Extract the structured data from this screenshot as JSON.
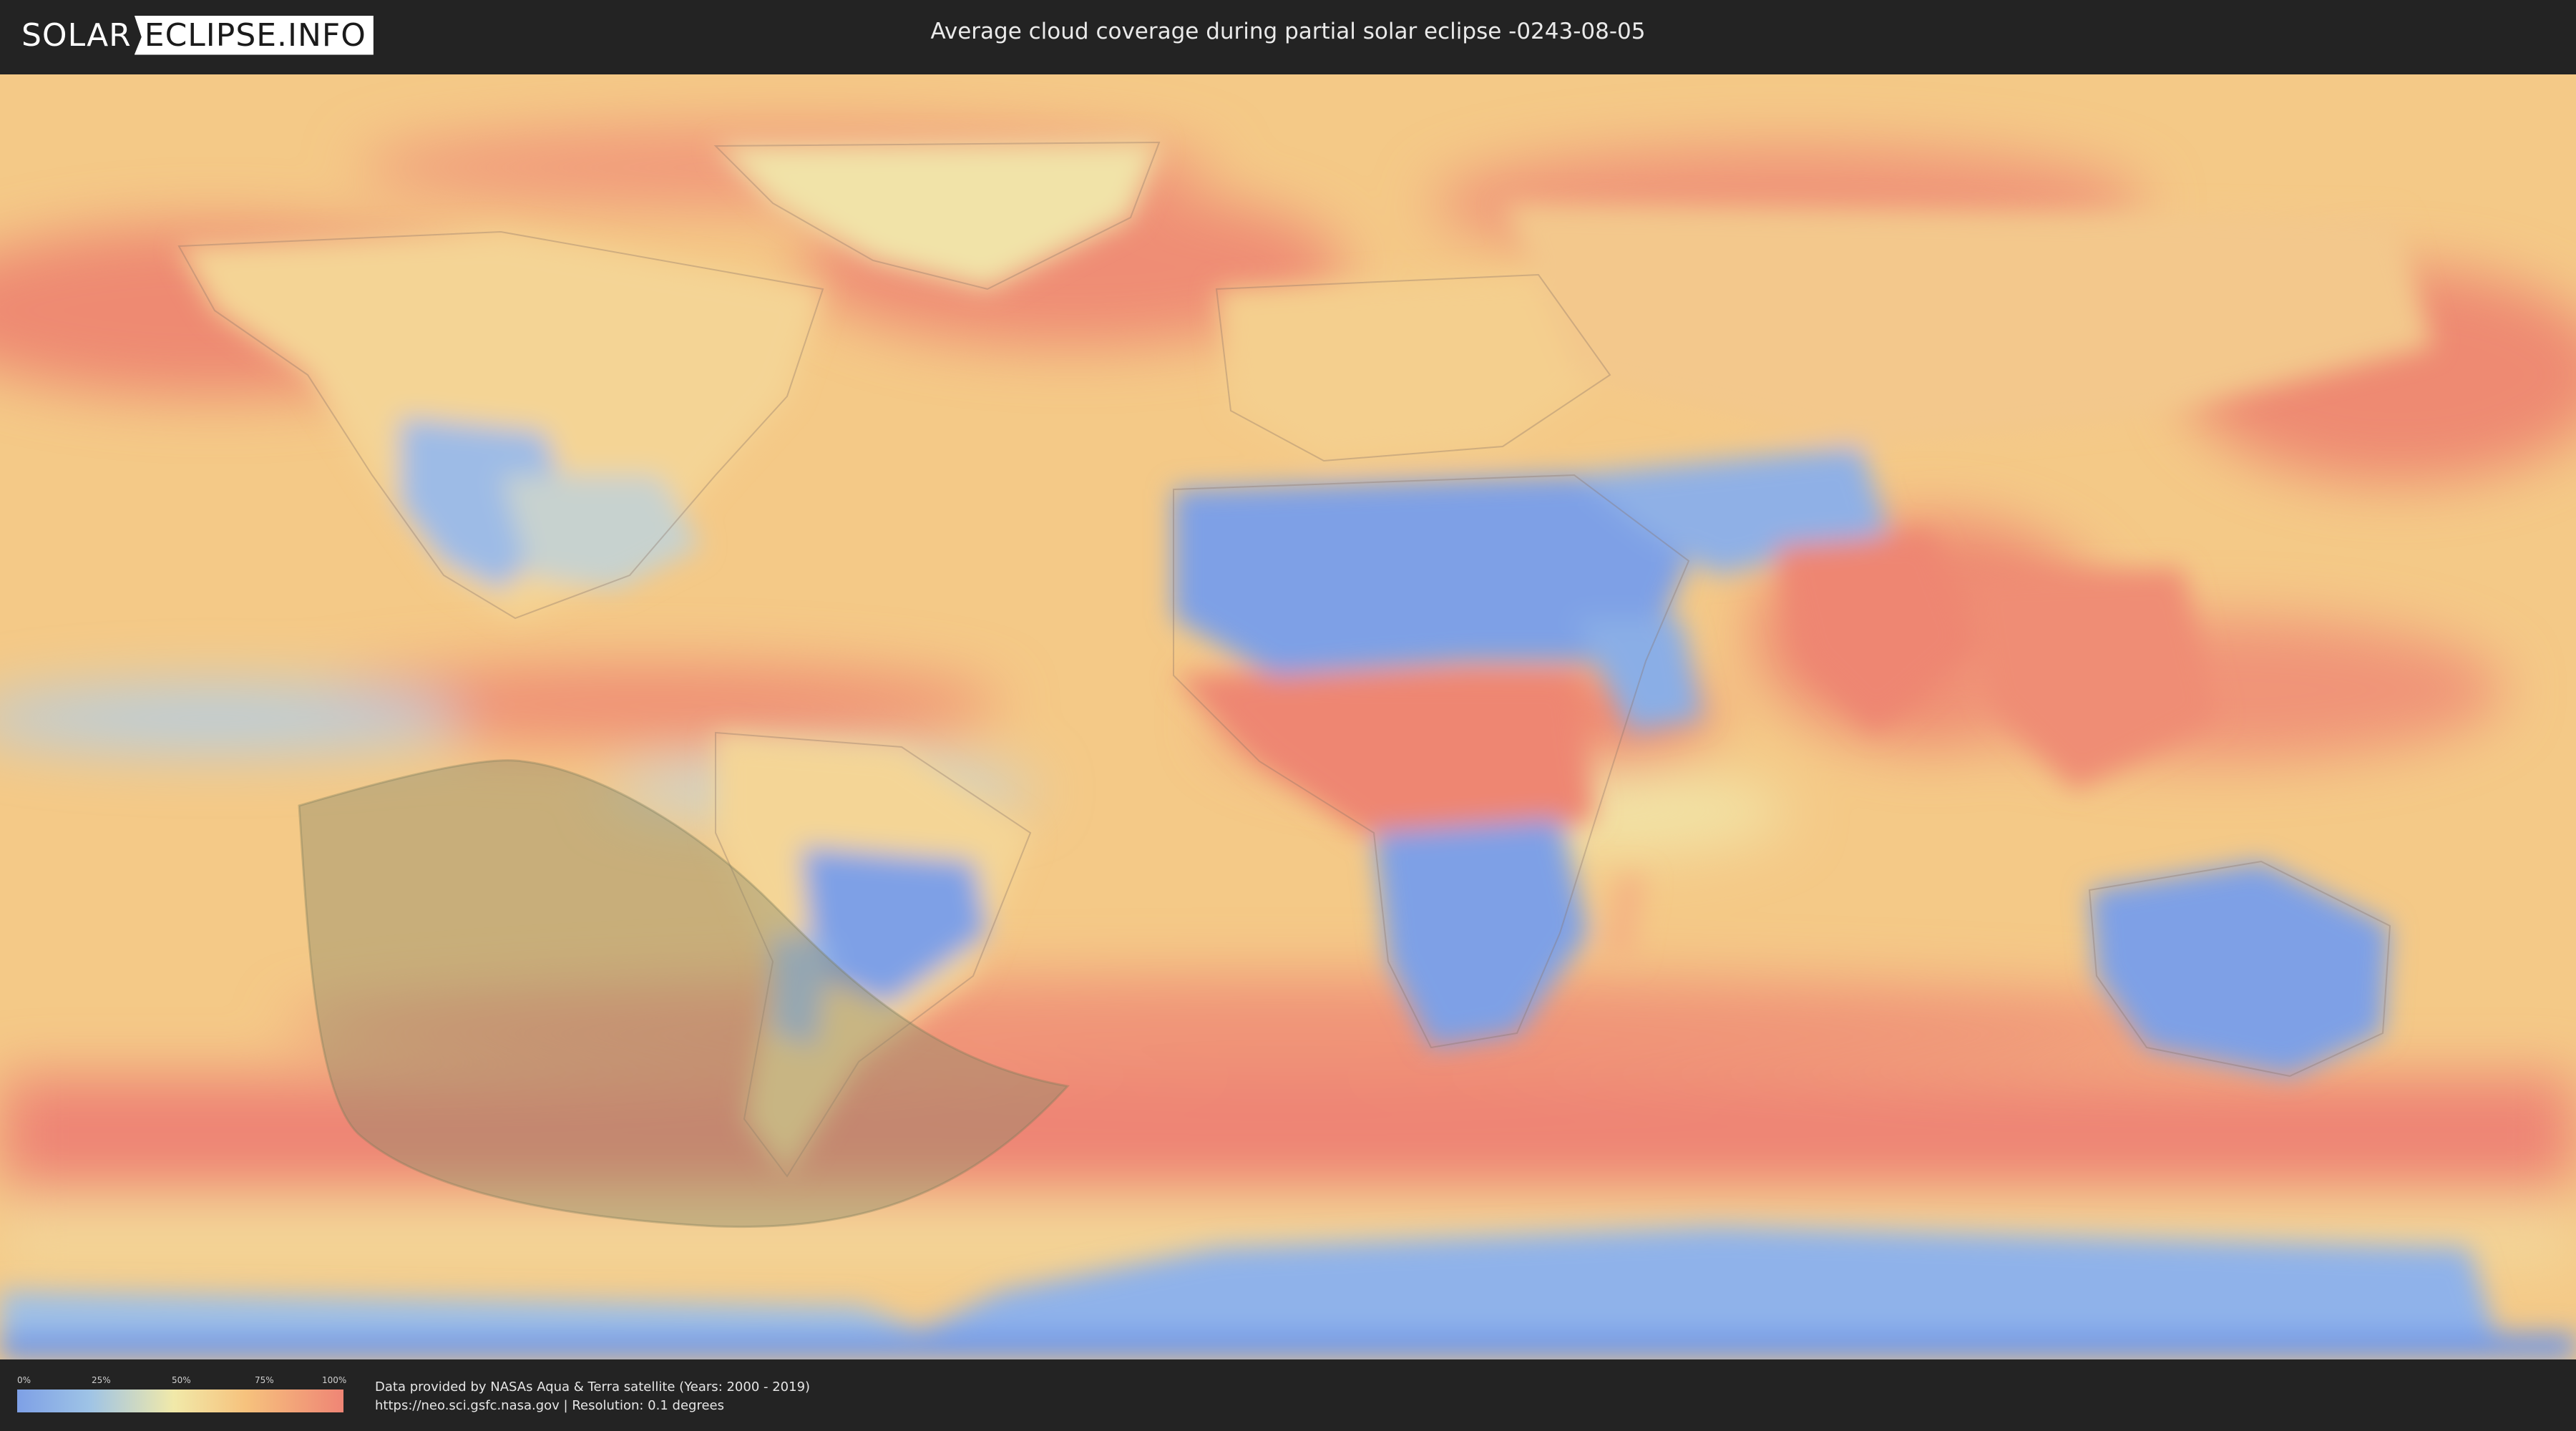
{
  "header": {
    "logo_part1": "SOLAR",
    "logo_part2": "ECLIPSE.INFO",
    "title": "Average cloud coverage during partial solar eclipse -0243-08-05"
  },
  "legend": {
    "ticks": [
      "0%",
      "25%",
      "50%",
      "75%",
      "100%"
    ]
  },
  "footer": {
    "source_line": "Data provided by NASAs Aqua & Terra satellite (Years: 2000 - 2019)",
    "url_line": "https://neo.sci.gsfc.nasa.gov | Resolution: 0.1 degrees"
  },
  "colors": {
    "clear": "#7ea0e6",
    "low": "#9ec3e6",
    "mid": "#f1e9a9",
    "high": "#f6c27d",
    "overcast": "#ef8575",
    "eclipse_overlay": "#8a8a6a"
  },
  "map": {
    "projection": "equirectangular",
    "layer": "cloud-coverage",
    "eclipse_type": "partial"
  }
}
